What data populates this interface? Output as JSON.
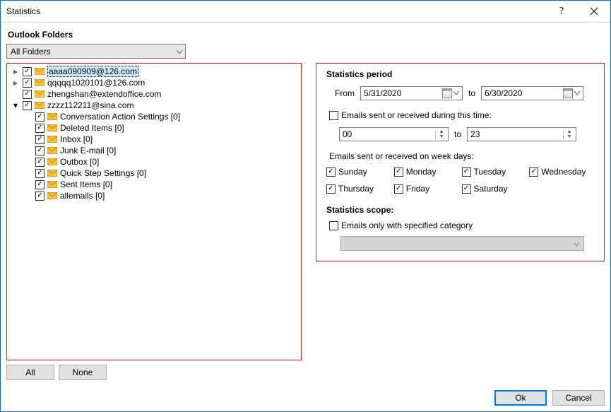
{
  "window": {
    "title": "Statistics"
  },
  "subheading": "Outlook Folders",
  "folderFilter": {
    "selected": "All Folders"
  },
  "tree": {
    "roots": [
      {
        "label": "aaaa090909@126.com",
        "expandable": true,
        "expanded": false,
        "checked": true,
        "selected": true
      },
      {
        "label": "qqqqq1020101@126.com",
        "expandable": true,
        "expanded": false,
        "checked": true,
        "selected": false
      },
      {
        "label": "zhengshan@extendoffice.com",
        "expandable": false,
        "expanded": false,
        "checked": true,
        "selected": false
      },
      {
        "label": "zzzz112211@sina.com",
        "expandable": true,
        "expanded": true,
        "checked": true,
        "selected": false
      }
    ],
    "children": [
      {
        "label": "Conversation Action Settings [0]",
        "checked": true
      },
      {
        "label": "Deleted Items [0]",
        "checked": true
      },
      {
        "label": "Inbox [0]",
        "checked": true
      },
      {
        "label": "Junk E-mail [0]",
        "checked": true
      },
      {
        "label": "Outbox [0]",
        "checked": true
      },
      {
        "label": "Quick Step Settings [0]",
        "checked": true
      },
      {
        "label": "Sent Items [0]",
        "checked": true
      },
      {
        "label": "allemails [0]",
        "checked": true
      }
    ]
  },
  "leftButtons": {
    "all": "All",
    "none": "None"
  },
  "period": {
    "title": "Statistics period",
    "fromLabel": "From",
    "fromValue": "5/31/2020",
    "toLabel": "to",
    "toValue": "6/30/2020",
    "timeCheckbox": {
      "checked": false,
      "label": "Emails sent or received during this time:"
    },
    "timeFrom": "00",
    "timeToLabel": "to",
    "timeTo": "23",
    "weekLabel": "Emails sent or received on week days:",
    "days": [
      {
        "label": "Sunday",
        "checked": true
      },
      {
        "label": "Monday",
        "checked": true
      },
      {
        "label": "Tuesday",
        "checked": true
      },
      {
        "label": "Wednesday",
        "checked": true
      },
      {
        "label": "Thursday",
        "checked": true
      },
      {
        "label": "Friday",
        "checked": true
      },
      {
        "label": "Saturday",
        "checked": true
      }
    ]
  },
  "scope": {
    "title": "Statistics scope:",
    "categoryCheckbox": {
      "checked": false,
      "label": "Emails only with specified category"
    }
  },
  "footer": {
    "ok": "Ok",
    "cancel": "Cancel"
  }
}
